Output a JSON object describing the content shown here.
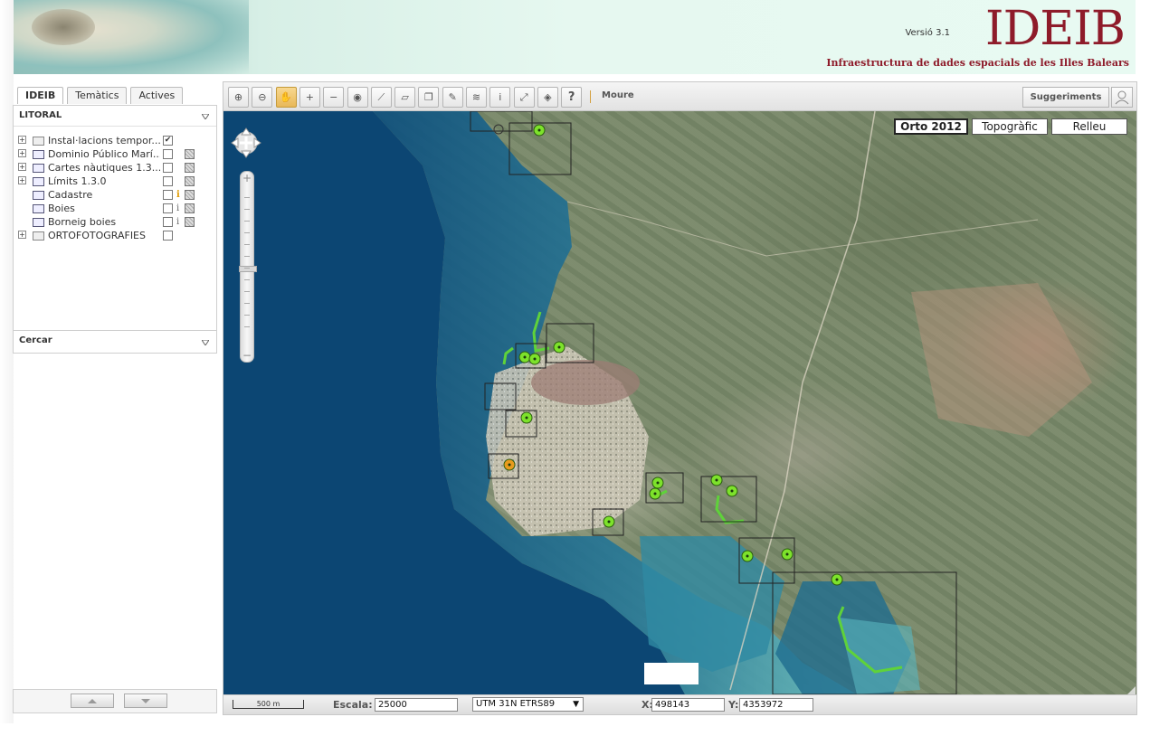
{
  "header": {
    "version": "Versió 3.1",
    "logo": "IDEIB",
    "subtitle": "Infraestructura de dades espacials de les Illes Balears"
  },
  "left_panel": {
    "tabs": [
      {
        "label": "IDEIB",
        "active": true
      },
      {
        "label": "Temàtics",
        "active": false
      },
      {
        "label": "Actives",
        "active": false
      }
    ],
    "section_title": "LITORAL",
    "layers": [
      {
        "name": "Instal·lacions tempor...",
        "expandable": true,
        "icon": "folder-icon",
        "checked": true,
        "info": false,
        "thumb": false
      },
      {
        "name": "Dominio Público Marí...",
        "expandable": true,
        "icon": "layers-icon",
        "checked": false,
        "info": false,
        "thumb": true
      },
      {
        "name": "Cartes nàutiques 1.3...",
        "expandable": true,
        "icon": "layers-icon",
        "checked": false,
        "info": false,
        "thumb": true
      },
      {
        "name": "Límits 1.3.0",
        "expandable": true,
        "icon": "layers-icon",
        "checked": false,
        "info": false,
        "thumb": true
      },
      {
        "name": "Cadastre",
        "expandable": false,
        "icon": "layer-icon",
        "checked": false,
        "info": true,
        "info_highlight": true,
        "thumb": true
      },
      {
        "name": "Boies",
        "expandable": false,
        "icon": "layer-icon",
        "checked": false,
        "info": true,
        "thumb": true
      },
      {
        "name": "Borneig boies",
        "expandable": false,
        "icon": "layer-icon",
        "checked": false,
        "info": true,
        "thumb": true
      },
      {
        "name": "ORTOFOTOGRAFIES",
        "expandable": true,
        "icon": "folder-icon",
        "checked": false,
        "info": false,
        "thumb": false
      }
    ],
    "search_title": "Cercar"
  },
  "toolbar": {
    "tools": [
      "zoom-in-box-icon",
      "zoom-out-box-icon",
      "pan-hand-icon",
      "zoom-in-icon",
      "zoom-out-icon",
      "globe-icon",
      "measure-distance-icon",
      "measure-area-icon",
      "copy-icon",
      "draw-icon",
      "layers-stack-icon",
      "info-icon",
      "fullscreen-icon",
      "rotate-icon",
      "help-icon"
    ],
    "active_tool": "pan-hand-icon",
    "mode_label": "Moure",
    "suggestions_label": "Suggeriments",
    "help_glyph": "?",
    "info_glyph": "i"
  },
  "map": {
    "base_layers": [
      {
        "label": "Orto 2012",
        "active": true
      },
      {
        "label": "Topogràfic",
        "active": false
      },
      {
        "label": "Relleu",
        "active": false
      }
    ],
    "zoom_plus": "+",
    "zoom_minus": "−",
    "zoom_level_fraction": 0.5
  },
  "status": {
    "scale_bar_label": "500 m",
    "scale_label": "Escala:",
    "scale_value": "25000",
    "crs": "UTM 31N ETRS89",
    "x_label": "X:",
    "x_value": "498143",
    "y_label": "Y:",
    "y_value": "4353972"
  },
  "colors": {
    "brand": "#8e1b2a",
    "marker_green": "#7de22b",
    "marker_orange": "#e89b1c",
    "sea_deep": "#0a4a78",
    "sea_shallow": "#4fb8c0",
    "route_green": "#5fd23a"
  }
}
